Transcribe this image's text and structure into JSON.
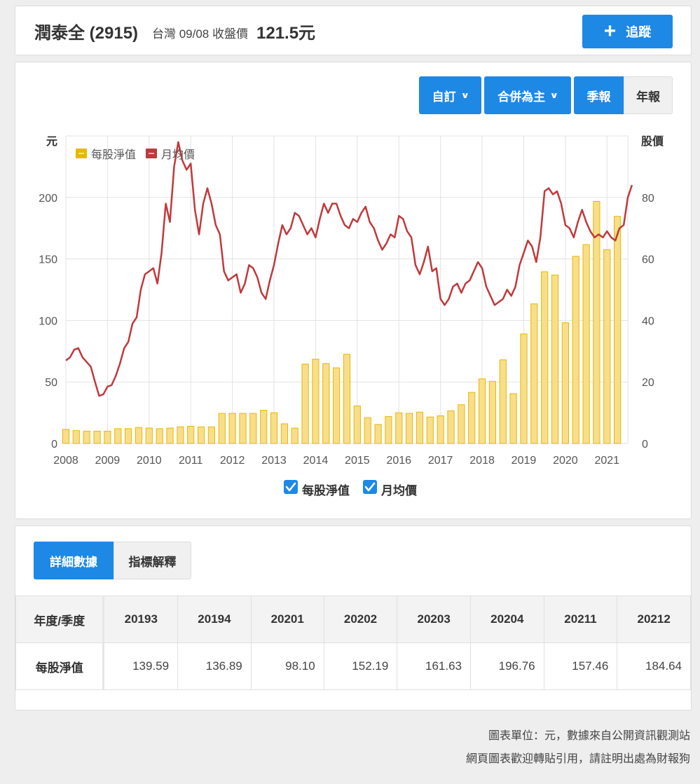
{
  "header": {
    "stock_name": "潤泰全 (2915)",
    "market_date_label": "台灣 09/08 收盤價",
    "close_price": "121.5元",
    "track_button": "追蹤",
    "track_icon": "plus-icon"
  },
  "toolbar": {
    "custom_label": "自訂",
    "consolidated_label": "合併為主",
    "quarterly_label": "季報",
    "annual_label": "年報",
    "dropdown_icon": "chevron-down-icon"
  },
  "colors": {
    "accent": "#1e88e5",
    "bar_fill": "#f8de8a",
    "bar_stroke": "#e6b800",
    "line": "#c0393b"
  },
  "chart_data": {
    "type": "bar+line",
    "left_axis_unit": "元",
    "right_axis_unit": "股價",
    "left_ylim": [
      0,
      250
    ],
    "right_ylim": [
      0,
      100
    ],
    "left_ticks": [
      "0",
      "50",
      "100",
      "150",
      "200"
    ],
    "right_ticks": [
      "0",
      "20",
      "40",
      "60",
      "80"
    ],
    "x_ticks": [
      "2008",
      "2009",
      "2010",
      "2011",
      "2012",
      "2013",
      "2014",
      "2015",
      "2016",
      "2017",
      "2018",
      "2019",
      "2020",
      "2021"
    ],
    "x_range": [
      2008.0,
      2021.5
    ],
    "legend": [
      {
        "name": "每股淨值",
        "color": "#e6b800"
      },
      {
        "name": "月均價",
        "color": "#c0393b"
      }
    ],
    "legend_position": "top-left",
    "grid": true,
    "checkboxes": [
      {
        "label": "每股淨值",
        "checked": true
      },
      {
        "label": "月均價",
        "checked": true
      }
    ],
    "series": [
      {
        "name": "每股淨值",
        "kind": "bar",
        "axis": "left",
        "x": [
          2008.0,
          2008.25,
          2008.5,
          2008.75,
          2009.0,
          2009.25,
          2009.5,
          2009.75,
          2010.0,
          2010.25,
          2010.5,
          2010.75,
          2011.0,
          2011.25,
          2011.5,
          2011.75,
          2012.0,
          2012.25,
          2012.5,
          2012.75,
          2013.0,
          2013.25,
          2013.5,
          2013.75,
          2014.0,
          2014.25,
          2014.5,
          2014.75,
          2015.0,
          2015.25,
          2015.5,
          2015.75,
          2016.0,
          2016.25,
          2016.5,
          2016.75,
          2017.0,
          2017.25,
          2017.5,
          2017.75,
          2018.0,
          2018.25,
          2018.5,
          2018.75,
          2019.0,
          2019.25,
          2019.5,
          2019.75,
          2020.0,
          2020.25,
          2020.5,
          2020.75,
          2021.0,
          2021.25
        ],
        "values": [
          11.5,
          10.5,
          10.0,
          10.0,
          10.0,
          12.0,
          12.0,
          13.0,
          12.5,
          12.0,
          12.5,
          13.5,
          14.0,
          13.5,
          13.5,
          24.5,
          24.5,
          24.5,
          24.5,
          27.0,
          25.0,
          16.0,
          12.5,
          64.5,
          68.5,
          65.0,
          61.5,
          72.5,
          30.5,
          21.0,
          15.5,
          22.0,
          25.0,
          24.5,
          25.5,
          21.5,
          22.5,
          26.5,
          31.5,
          41.5,
          52.5,
          50.5,
          68.0,
          40.5,
          89.0,
          113.5,
          139.59,
          136.89,
          98.1,
          152.19,
          161.63,
          196.76,
          157.46,
          184.64
        ]
      },
      {
        "name": "月均價",
        "kind": "line",
        "axis": "right",
        "points": [
          [
            2008.0,
            27
          ],
          [
            2008.1,
            28
          ],
          [
            2008.2,
            30.5
          ],
          [
            2008.3,
            31
          ],
          [
            2008.4,
            28
          ],
          [
            2008.5,
            26.5
          ],
          [
            2008.6,
            25
          ],
          [
            2008.7,
            20
          ],
          [
            2008.8,
            15.5
          ],
          [
            2008.9,
            16
          ],
          [
            2009.0,
            18.5
          ],
          [
            2009.1,
            19
          ],
          [
            2009.2,
            22
          ],
          [
            2009.3,
            26
          ],
          [
            2009.4,
            31
          ],
          [
            2009.5,
            33
          ],
          [
            2009.6,
            39
          ],
          [
            2009.7,
            41
          ],
          [
            2009.8,
            50
          ],
          [
            2009.9,
            55
          ],
          [
            2010.0,
            56
          ],
          [
            2010.1,
            57
          ],
          [
            2010.2,
            52
          ],
          [
            2010.3,
            62
          ],
          [
            2010.4,
            78
          ],
          [
            2010.5,
            72
          ],
          [
            2010.6,
            90
          ],
          [
            2010.7,
            98
          ],
          [
            2010.8,
            92
          ],
          [
            2010.9,
            89
          ],
          [
            2011.0,
            91
          ],
          [
            2011.1,
            76
          ],
          [
            2011.2,
            68
          ],
          [
            2011.3,
            78
          ],
          [
            2011.4,
            83
          ],
          [
            2011.5,
            78
          ],
          [
            2011.6,
            71
          ],
          [
            2011.7,
            68
          ],
          [
            2011.8,
            56
          ],
          [
            2011.9,
            53
          ],
          [
            2012.0,
            54
          ],
          [
            2012.1,
            55
          ],
          [
            2012.2,
            49
          ],
          [
            2012.3,
            52
          ],
          [
            2012.4,
            58
          ],
          [
            2012.5,
            57
          ],
          [
            2012.6,
            54
          ],
          [
            2012.7,
            49
          ],
          [
            2012.8,
            47
          ],
          [
            2012.9,
            53
          ],
          [
            2013.0,
            58
          ],
          [
            2013.1,
            65
          ],
          [
            2013.2,
            71
          ],
          [
            2013.3,
            68
          ],
          [
            2013.4,
            70
          ],
          [
            2013.5,
            75
          ],
          [
            2013.6,
            74
          ],
          [
            2013.7,
            71
          ],
          [
            2013.8,
            68
          ],
          [
            2013.9,
            70
          ],
          [
            2014.0,
            67
          ],
          [
            2014.1,
            73
          ],
          [
            2014.2,
            78
          ],
          [
            2014.3,
            75
          ],
          [
            2014.4,
            78
          ],
          [
            2014.5,
            78
          ],
          [
            2014.6,
            74
          ],
          [
            2014.7,
            71
          ],
          [
            2014.8,
            70
          ],
          [
            2014.9,
            73
          ],
          [
            2015.0,
            72
          ],
          [
            2015.1,
            75
          ],
          [
            2015.2,
            77
          ],
          [
            2015.3,
            72
          ],
          [
            2015.4,
            70
          ],
          [
            2015.5,
            66
          ],
          [
            2015.6,
            63
          ],
          [
            2015.7,
            65
          ],
          [
            2015.8,
            68
          ],
          [
            2015.9,
            67
          ],
          [
            2016.0,
            74
          ],
          [
            2016.1,
            73
          ],
          [
            2016.2,
            69
          ],
          [
            2016.3,
            67
          ],
          [
            2016.4,
            58
          ],
          [
            2016.5,
            55
          ],
          [
            2016.6,
            59
          ],
          [
            2016.7,
            64
          ],
          [
            2016.8,
            56
          ],
          [
            2016.9,
            57
          ],
          [
            2017.0,
            47
          ],
          [
            2017.1,
            45
          ],
          [
            2017.2,
            47
          ],
          [
            2017.3,
            51
          ],
          [
            2017.4,
            52
          ],
          [
            2017.5,
            49
          ],
          [
            2017.6,
            52
          ],
          [
            2017.7,
            53
          ],
          [
            2017.8,
            56
          ],
          [
            2017.9,
            59
          ],
          [
            2018.0,
            57
          ],
          [
            2018.1,
            51
          ],
          [
            2018.2,
            48
          ],
          [
            2018.3,
            45
          ],
          [
            2018.4,
            46
          ],
          [
            2018.5,
            47
          ],
          [
            2018.6,
            50
          ],
          [
            2018.7,
            48
          ],
          [
            2018.8,
            51
          ],
          [
            2018.9,
            58
          ],
          [
            2019.0,
            62
          ],
          [
            2019.1,
            66
          ],
          [
            2019.2,
            64
          ],
          [
            2019.3,
            59
          ],
          [
            2019.4,
            67
          ],
          [
            2019.5,
            82
          ],
          [
            2019.6,
            83
          ],
          [
            2019.7,
            81
          ],
          [
            2019.8,
            82
          ],
          [
            2019.9,
            78
          ],
          [
            2020.0,
            71
          ],
          [
            2020.1,
            70
          ],
          [
            2020.2,
            67
          ],
          [
            2020.3,
            72
          ],
          [
            2020.4,
            76
          ],
          [
            2020.5,
            72
          ],
          [
            2020.6,
            69
          ],
          [
            2020.7,
            67
          ],
          [
            2020.8,
            68
          ],
          [
            2020.9,
            67
          ],
          [
            2021.0,
            69
          ],
          [
            2021.1,
            67
          ],
          [
            2021.2,
            66
          ],
          [
            2021.3,
            70
          ],
          [
            2021.4,
            71
          ],
          [
            2021.5,
            80
          ],
          [
            2021.6,
            84
          ]
        ]
      }
    ]
  },
  "tabs": {
    "detail_label": "詳細數據",
    "explain_label": "指標解釋"
  },
  "table": {
    "row_header_label": "年度/季度",
    "columns": [
      "20193",
      "20194",
      "20201",
      "20202",
      "20203",
      "20204",
      "20211",
      "20212"
    ],
    "rows": [
      {
        "label": "每股淨值",
        "values": [
          "139.59",
          "136.89",
          "98.10",
          "152.19",
          "161.63",
          "196.76",
          "157.46",
          "184.64"
        ]
      }
    ]
  },
  "footer": {
    "line1": "圖表單位：元，數據來自公開資訊觀測站",
    "line2": "網頁圖表歡迎轉貼引用，請註明出處為財報狗"
  }
}
